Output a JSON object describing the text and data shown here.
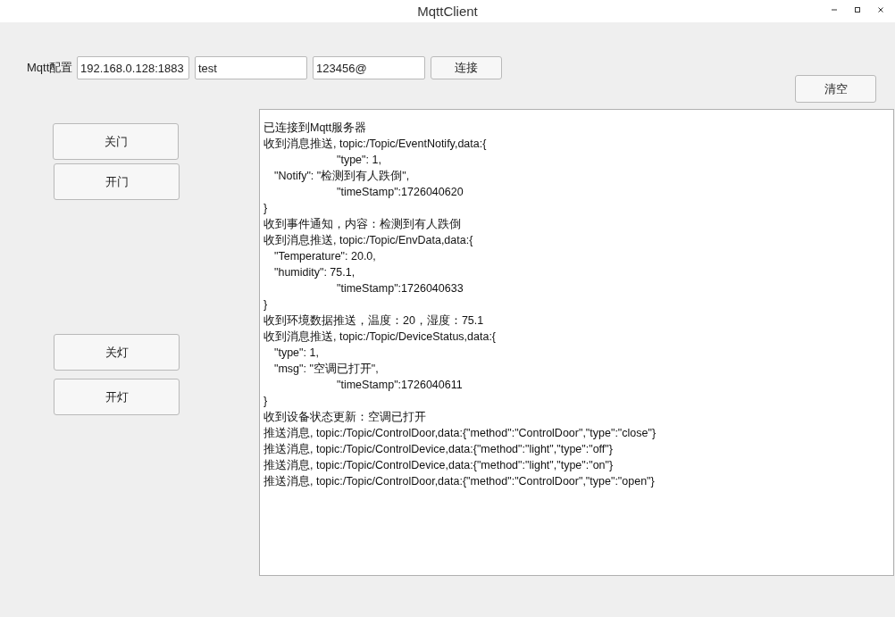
{
  "window": {
    "title": "MqttClient"
  },
  "config": {
    "label": "Mqtt配置",
    "fields": [
      {
        "value": "192.168.0.128:1883"
      },
      {
        "value": "test"
      },
      {
        "value": "123456@"
      }
    ],
    "connect_button": "连接"
  },
  "clear_button": "清空",
  "door_buttons": [
    "关门",
    "开门"
  ],
  "light_buttons": [
    "关灯",
    "开灯"
  ],
  "log": [
    {
      "kind": "plain",
      "text": "已连接到Mqtt服务器"
    },
    {
      "kind": "plain",
      "text": "收到消息推送, topic:/Topic/EventNotify,data:{"
    },
    {
      "kind": "deep",
      "text": "\"type\": 1,"
    },
    {
      "kind": "field",
      "text": "\"Notify\": \"检测到有人跌倒\","
    },
    {
      "kind": "deep",
      "text": "\"timeStamp\":1726040620"
    },
    {
      "kind": "plain",
      "text": "}"
    },
    {
      "kind": "plain",
      "text": "收到事件通知，内容：检测到有人跌倒"
    },
    {
      "kind": "plain",
      "text": "收到消息推送, topic:/Topic/EnvData,data:{"
    },
    {
      "kind": "field",
      "text": "\"Temperature\": 20.0,"
    },
    {
      "kind": "field",
      "text": "\"humidity\": 75.1,"
    },
    {
      "kind": "deep",
      "text": "\"timeStamp\":1726040633"
    },
    {
      "kind": "plain",
      "text": "}"
    },
    {
      "kind": "plain",
      "text": "收到环境数据推送，温度：20，湿度：75.1"
    },
    {
      "kind": "plain",
      "text": "收到消息推送, topic:/Topic/DeviceStatus,data:{"
    },
    {
      "kind": "field",
      "text": "\"type\": 1,"
    },
    {
      "kind": "field",
      "text": "\"msg\": \"空调已打开\","
    },
    {
      "kind": "deep",
      "text": "\"timeStamp\":1726040611"
    },
    {
      "kind": "plain",
      "text": "}"
    },
    {
      "kind": "plain",
      "text": "收到设备状态更新：空调已打开"
    },
    {
      "kind": "plain",
      "text": "推送消息, topic:/Topic/ControlDoor,data:{\"method\":\"ControlDoor\",\"type\":\"close\"}"
    },
    {
      "kind": "plain",
      "text": "推送消息, topic:/Topic/ControlDevice,data:{\"method\":\"light\",\"type\":\"off\"}"
    },
    {
      "kind": "plain",
      "text": "推送消息, topic:/Topic/ControlDevice,data:{\"method\":\"light\",\"type\":\"on\"}"
    },
    {
      "kind": "plain",
      "text": "推送消息, topic:/Topic/ControlDoor,data:{\"method\":\"ControlDoor\",\"type\":\"open\"}"
    }
  ]
}
